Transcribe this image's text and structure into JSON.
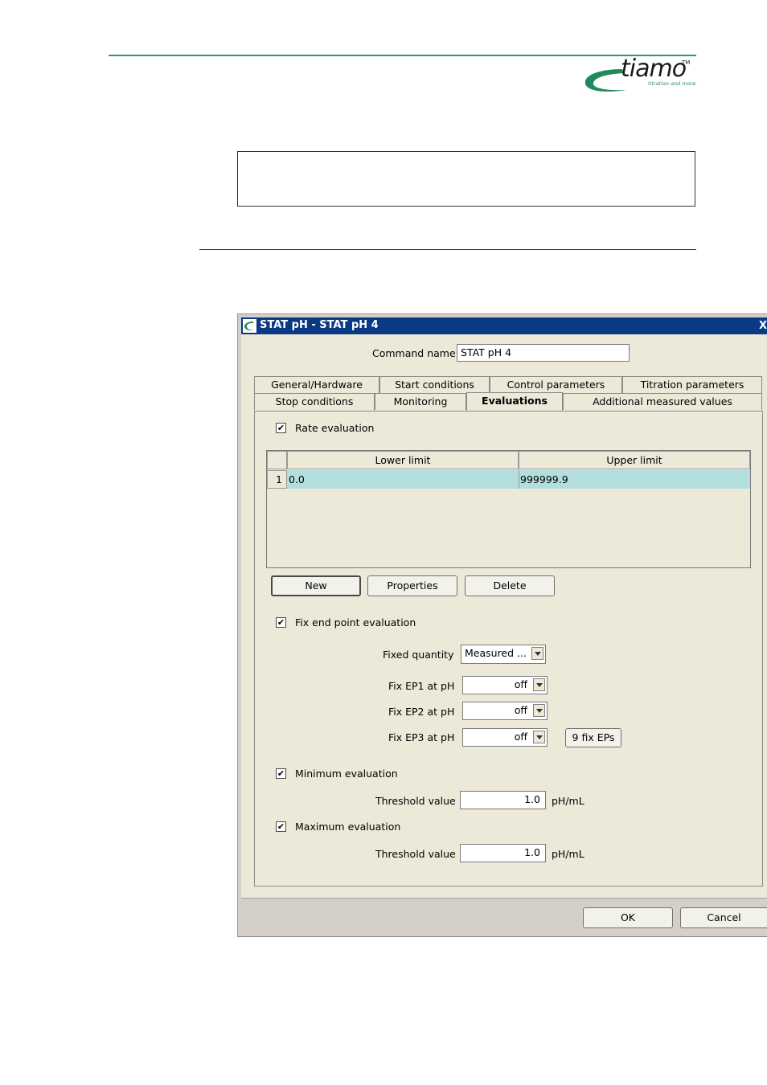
{
  "brand": {
    "name": "tiamo",
    "tm": "TM",
    "tagline": "titration and more",
    "color": "#2a9a6a"
  },
  "dialog": {
    "title": "STAT pH - STAT pH 4",
    "close": "X",
    "command_name_label": "Command name",
    "command_name_value": "STAT pH 4",
    "tabs_row1": [
      "General/Hardware",
      "Start conditions",
      "Control parameters",
      "Titration parameters"
    ],
    "tabs_row2": [
      "Stop conditions",
      "Monitoring",
      "Evaluations",
      "Additional measured values"
    ],
    "active_tab": "Evaluations",
    "rate_evaluation": {
      "label": "Rate evaluation",
      "checked": true
    },
    "table": {
      "columns": [
        "Lower limit",
        "Upper limit"
      ],
      "rows": [
        {
          "index": "1",
          "lower": "0.0",
          "upper": "999999.9"
        }
      ]
    },
    "buttons": {
      "new": "New",
      "properties": "Properties",
      "delete": "Delete"
    },
    "fix_ep": {
      "label": "Fix end point evaluation",
      "checked": true,
      "fixed_quantity_label": "Fixed quantity",
      "fixed_quantity_value": "Measured ...",
      "ep1_label": "Fix EP1 at pH",
      "ep1_value": "off",
      "ep2_label": "Fix EP2 at pH",
      "ep2_value": "off",
      "ep3_label": "Fix EP3 at pH",
      "ep3_value": "off",
      "more_button": "9 fix EPs"
    },
    "minimum": {
      "label": "Minimum evaluation",
      "checked": true,
      "threshold_label": "Threshold value",
      "threshold_value": "1.0",
      "unit": "pH/mL"
    },
    "maximum": {
      "label": "Maximum evaluation",
      "checked": true,
      "threshold_label": "Threshold value",
      "threshold_value": "1.0",
      "unit": "pH/mL"
    },
    "ok": "OK",
    "cancel": "Cancel",
    "checkmark": "✔"
  }
}
